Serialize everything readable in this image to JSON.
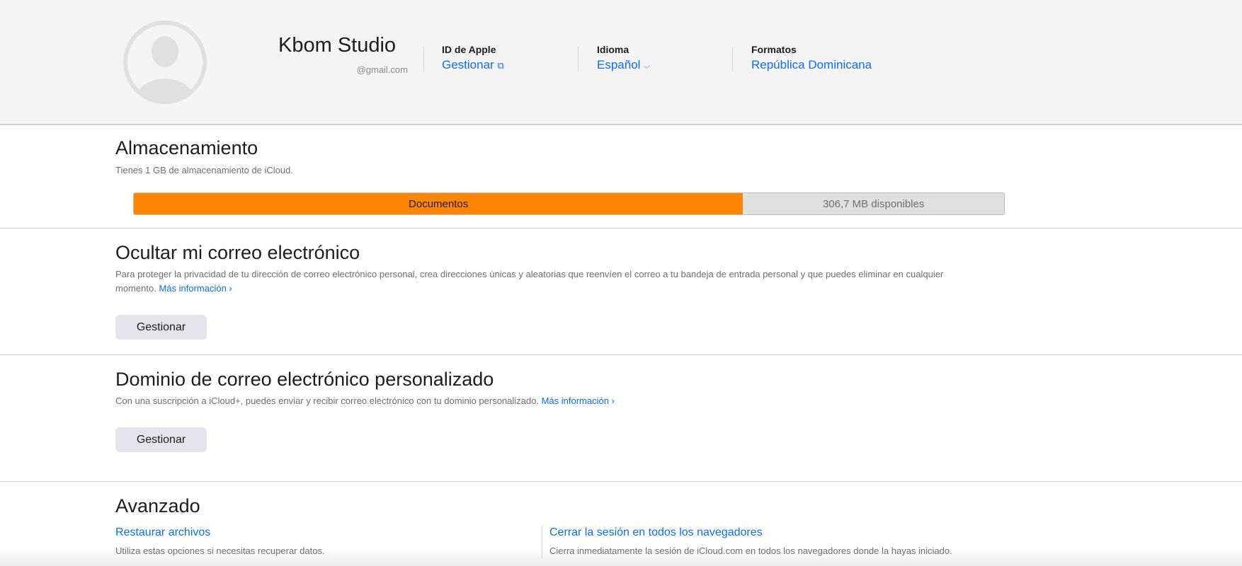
{
  "header": {
    "name": "Kbom Studio",
    "email": "@gmail.com",
    "apple_id": {
      "label": "ID de Apple",
      "link": "Gestionar"
    },
    "language": {
      "label": "Idioma",
      "link": "Español"
    },
    "formats": {
      "label": "Formatos",
      "link": "República Dominicana"
    }
  },
  "storage": {
    "title": "Almacenamiento",
    "subtitle": "Tienes 1 GB de almacenamiento de iCloud.",
    "used_label": "Documentos",
    "free_label": "306,7 MB disponibles",
    "used_fraction": 0.7,
    "used_color": "#fc8505"
  },
  "hide_email": {
    "title": "Ocultar mi correo electrónico",
    "text_line1": "Para proteger la privacidad de tu dirección de correo electrónico personal, crea direcciones únicas y aleatorias que reenvíen el correo a tu bandeja de entrada personal y que puedes eliminar en cualquier",
    "text_line2": "momento.",
    "more_link": "Más información",
    "button": "Gestionar"
  },
  "custom_domain": {
    "title": "Dominio de correo electrónico personalizado",
    "text": "Con una suscripción a iCloud+, puedes enviar y recibir correo electrónico con tu dominio personalizado.",
    "more_link": "Más información",
    "button": "Gestionar"
  },
  "advanced": {
    "title": "Avanzado",
    "restore": {
      "link": "Restaurar archivos",
      "text": "Utiliza estas opciones si necesitas recuperar datos."
    },
    "signout": {
      "link": "Cerrar la sesión en todos los navegadores",
      "text": "Cierra inmediatamente la sesión de iCloud.com en todos los navegadores donde la hayas iniciado."
    }
  },
  "accent_color": "#0a6dff"
}
